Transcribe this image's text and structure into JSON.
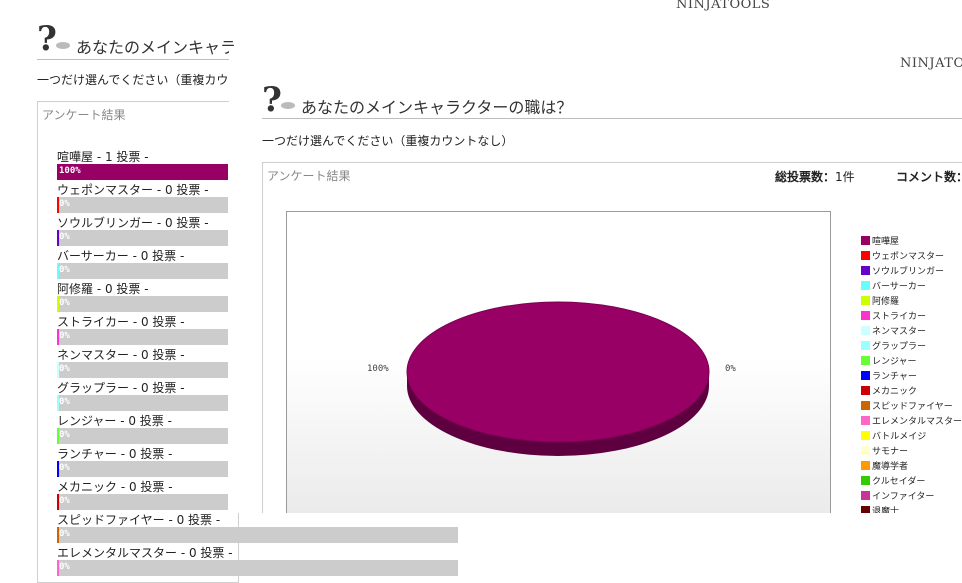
{
  "brand": "NINJATOOLS",
  "back_page": {
    "title": "あなたのメインキャラクターの職は？",
    "instruction": "一つだけ選んでください（重複カウントなし）",
    "results_heading": "アンケート結果",
    "items": [
      {
        "label": "喧嘩屋 - 1 投票 -",
        "pct": "100%",
        "value": 1.0,
        "color": "#990066"
      },
      {
        "label": "ウェポンマスター - 0 投票 -",
        "pct": "0%",
        "value": 0,
        "color": "#ff0000"
      },
      {
        "label": "ソウルブリンガー - 0 投票 -",
        "pct": "0%",
        "value": 0,
        "color": "#6600cc"
      },
      {
        "label": "バーサーカー - 0 投票 -",
        "pct": "0%",
        "value": 0,
        "color": "#66ffff"
      },
      {
        "label": "阿修羅 - 0 投票 -",
        "pct": "0%",
        "value": 0,
        "color": "#ccff00"
      },
      {
        "label": "ストライカー - 0 投票 -",
        "pct": "0%",
        "value": 0,
        "color": "#ff33cc"
      },
      {
        "label": "ネンマスター - 0 投票 -",
        "pct": "0%",
        "value": 0,
        "color": "#ccffff"
      },
      {
        "label": "グラップラー - 0 投票 -",
        "pct": "0%",
        "value": 0,
        "color": "#99ffff"
      },
      {
        "label": "レンジャー - 0 投票 -",
        "pct": "0%",
        "value": 0,
        "color": "#66ff33"
      },
      {
        "label": "ランチャー - 0 投票 -",
        "pct": "0%",
        "value": 0,
        "color": "#0000ff"
      },
      {
        "label": "メカニック - 0 投票 -",
        "pct": "0%",
        "value": 0,
        "color": "#cc0000"
      },
      {
        "label": "スピッドファイヤー - 0 投票 -",
        "pct": "0%",
        "value": 0,
        "color": "#cc6600"
      },
      {
        "label": "エレメンタルマスター - 0 投票 -",
        "pct": "0%",
        "value": 0,
        "color": "#ff66cc"
      }
    ]
  },
  "front_page": {
    "title": "あなたのメインキャラクターの職は？",
    "instruction": "一つだけ選んでください（重複カウントなし）",
    "results_heading": "アンケート結果",
    "total_votes_label": "総投票数：",
    "total_votes_value": "1件",
    "comments_label": "コメント数：",
    "pie_label_left": "100%",
    "pie_label_right": "0%"
  },
  "chart_data": {
    "type": "pie",
    "title": "",
    "categories": [
      "喧嘩屋",
      "ウェポンマスター",
      "ソウルブリンガー",
      "バーサーカー",
      "阿修羅",
      "ストライカー",
      "ネンマスター",
      "グラップラー",
      "レンジャー",
      "ランチャー",
      "メカニック",
      "スピッドファイヤー",
      "エレメンタルマスター",
      "バトルメイジ",
      "サモナー",
      "魔導学者",
      "クルセイダー",
      "インファイター",
      "退魔士"
    ],
    "values": [
      100,
      0,
      0,
      0,
      0,
      0,
      0,
      0,
      0,
      0,
      0,
      0,
      0,
      0,
      0,
      0,
      0,
      0,
      0
    ],
    "colors": [
      "#990066",
      "#ff0000",
      "#6600cc",
      "#66ffff",
      "#ccff00",
      "#ff33cc",
      "#ccffff",
      "#99ffff",
      "#66ff33",
      "#0000ff",
      "#cc0000",
      "#cc6600",
      "#ff66cc",
      "#ffff00",
      "#ffffcc",
      "#ff9900",
      "#33cc00",
      "#cc3399",
      "#660000"
    ],
    "legend_position": "right",
    "data_labels": [
      "100%",
      "0%"
    ]
  }
}
